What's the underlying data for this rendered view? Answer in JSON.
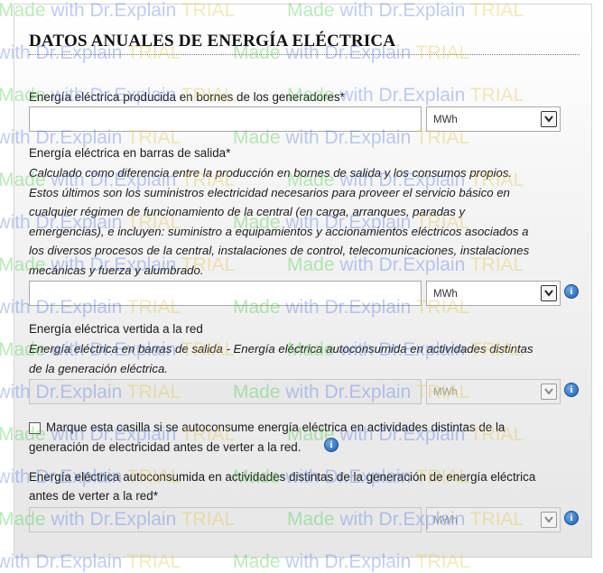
{
  "title": "DATOS ANUALES DE ENERGÍA ELÉCTRICA",
  "fields": {
    "produced": {
      "label": "Energía eléctrica producida en bornes de los generadores*",
      "value": "",
      "unit": "MWh"
    },
    "busbar": {
      "label": "Energía eléctrica en barras de salida*",
      "description_lines": [
        "Calculado como diferencia entre la producción en bornes de salida y los consumos propios.",
        "Estos últimos son los suministros electricidad necesarios para proveer el servicio básico en",
        "cualquier régimen de funcionamiento de la central (en carga, arranques, paradas y",
        "emergencias), e incluyen: suministro a equipamientos y accionamientos eléctricos asociados a",
        "los diversos procesos de la central, instalaciones de control, telecomunicaciones, instalaciones",
        "mecánicas y fuerza y alumbrado."
      ],
      "value": "",
      "unit": "MWh"
    },
    "grid": {
      "label": "Energía eléctrica vertida a la red",
      "description_lines": [
        "Energía eléctrica en barras de salida - Energía eléctrica autoconsumida en actividades distintas",
        "de la generación eléctrica."
      ],
      "value": "",
      "unit": "MWh"
    },
    "checkbox": {
      "label_lines": [
        "Marque esta casilla si se autoconsume energía eléctrica en actividades distintas de la",
        "generación de electricidad antes de verter a la red."
      ],
      "checked": false
    },
    "selfconsumed": {
      "label_lines": [
        "Energía eléctrica autoconsumida en actividades distintas de la generación de energía eléctrica",
        "antes de verter a la red*"
      ],
      "value": "",
      "unit": "MWh"
    }
  },
  "icons": {
    "info": "info-icon",
    "chevron": "chevron-down-icon"
  },
  "watermark": {
    "made": "Made",
    "with": "with Dr.Explain",
    "trial": "TRIAL"
  },
  "colors": {
    "info_blue": "#1a5fb4",
    "watermark_green": "#37c837",
    "watermark_blue": "#4a6fe0",
    "watermark_yellow": "#e0c23a"
  }
}
